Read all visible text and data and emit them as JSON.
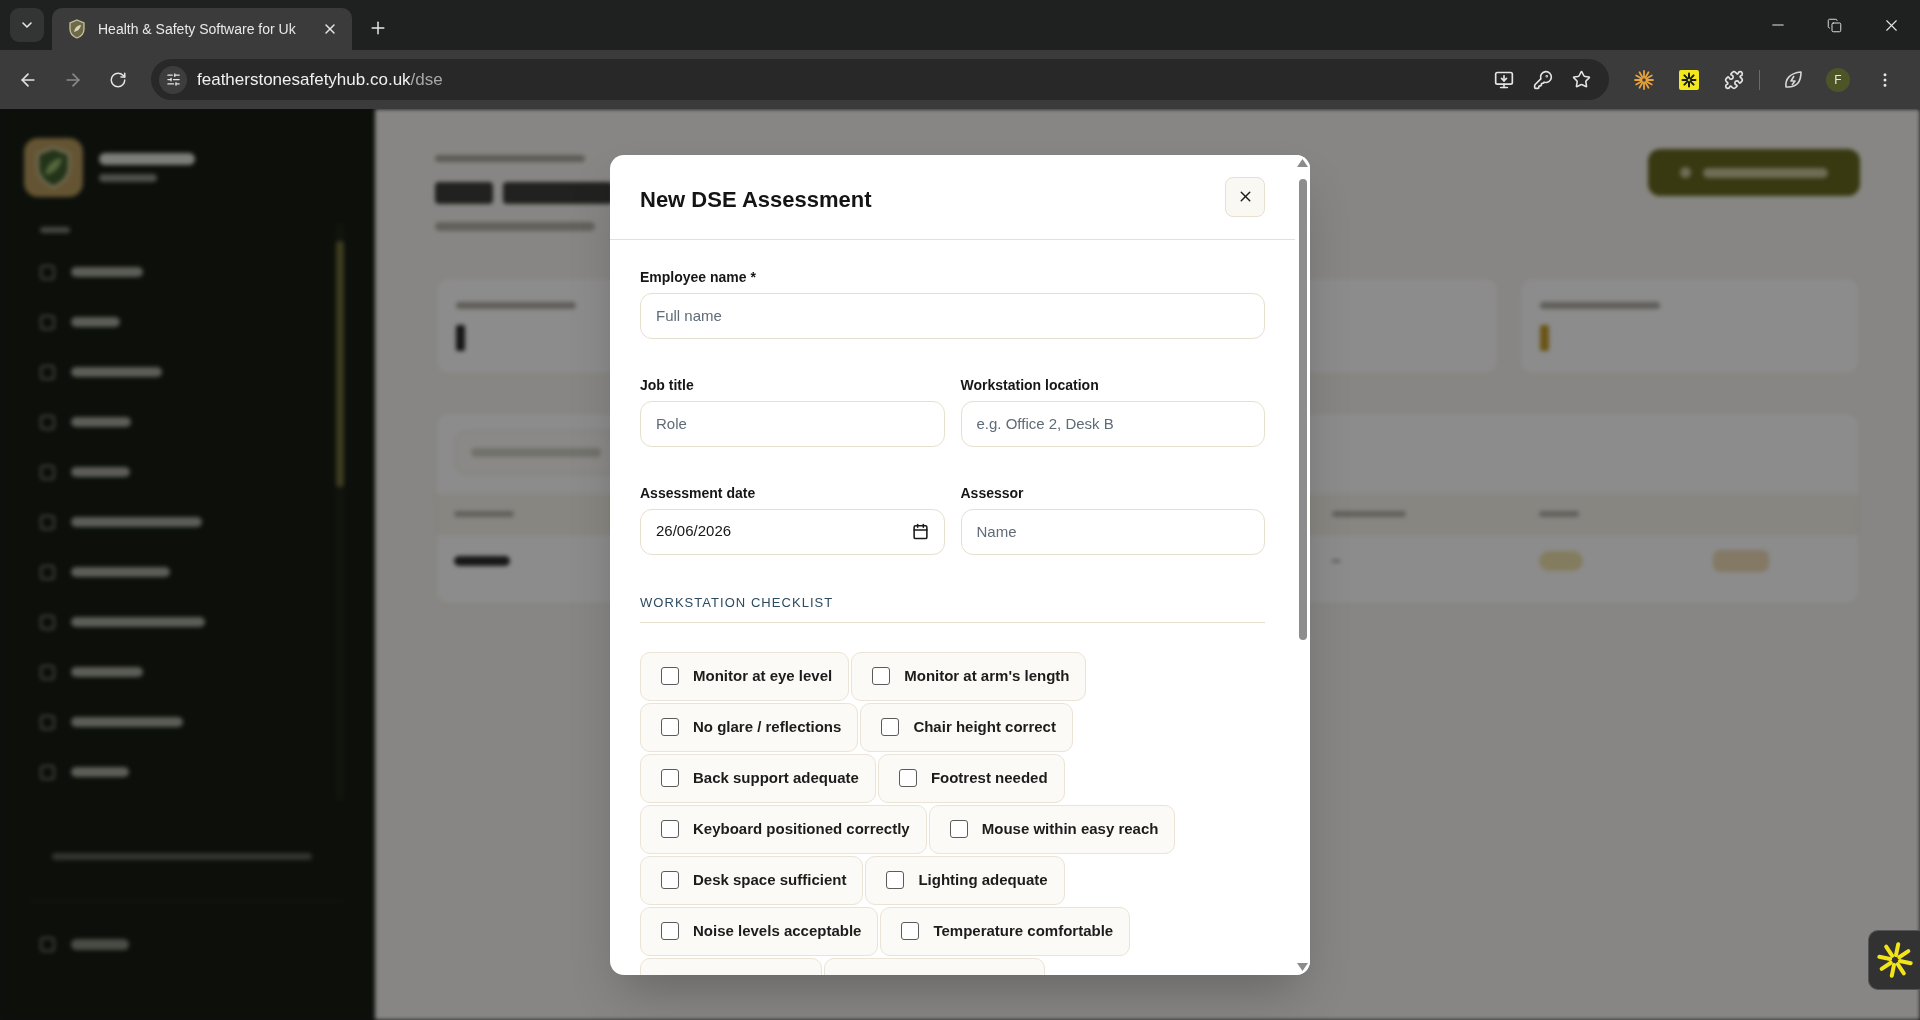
{
  "browser": {
    "tab": {
      "title": "Health & Safety Software for Uk"
    },
    "address": {
      "host": "featherstonesafetyhub.co.uk",
      "path": "/dse"
    },
    "profile_initial": "F"
  },
  "modal": {
    "title": "New DSE Assessment",
    "field_rows": [
      [
        {
          "label": "Employee name *",
          "placeholder": "Full name",
          "kind": "text"
        }
      ],
      [
        {
          "label": "Job title",
          "placeholder": "Role",
          "kind": "text"
        },
        {
          "label": "Workstation location",
          "placeholder": "e.g. Office 2, Desk B",
          "kind": "text"
        }
      ],
      [
        {
          "label": "Assessment date",
          "value": "26/06/2026",
          "kind": "date"
        },
        {
          "label": "Assessor",
          "placeholder": "Name",
          "kind": "text"
        }
      ]
    ],
    "checklist_heading": "WORKSTATION CHECKLIST",
    "checklist": [
      {
        "label": "Monitor at eye level",
        "checked": false
      },
      {
        "label": "Monitor at arm's length",
        "checked": false
      },
      {
        "label": "No glare / reflections",
        "checked": false
      },
      {
        "label": "Chair height correct",
        "checked": false
      },
      {
        "label": "Back support adequate",
        "checked": false
      },
      {
        "label": "Footrest needed",
        "checked": false
      },
      {
        "label": "Keyboard positioned correctly",
        "checked": false
      },
      {
        "label": "Mouse within easy reach",
        "checked": false
      },
      {
        "label": "Desk space sufficient",
        "checked": false
      },
      {
        "label": "Lighting adequate",
        "checked": false
      },
      {
        "label": "Noise levels acceptable",
        "checked": false
      },
      {
        "label": "Temperature comfortable",
        "checked": false
      }
    ]
  }
}
